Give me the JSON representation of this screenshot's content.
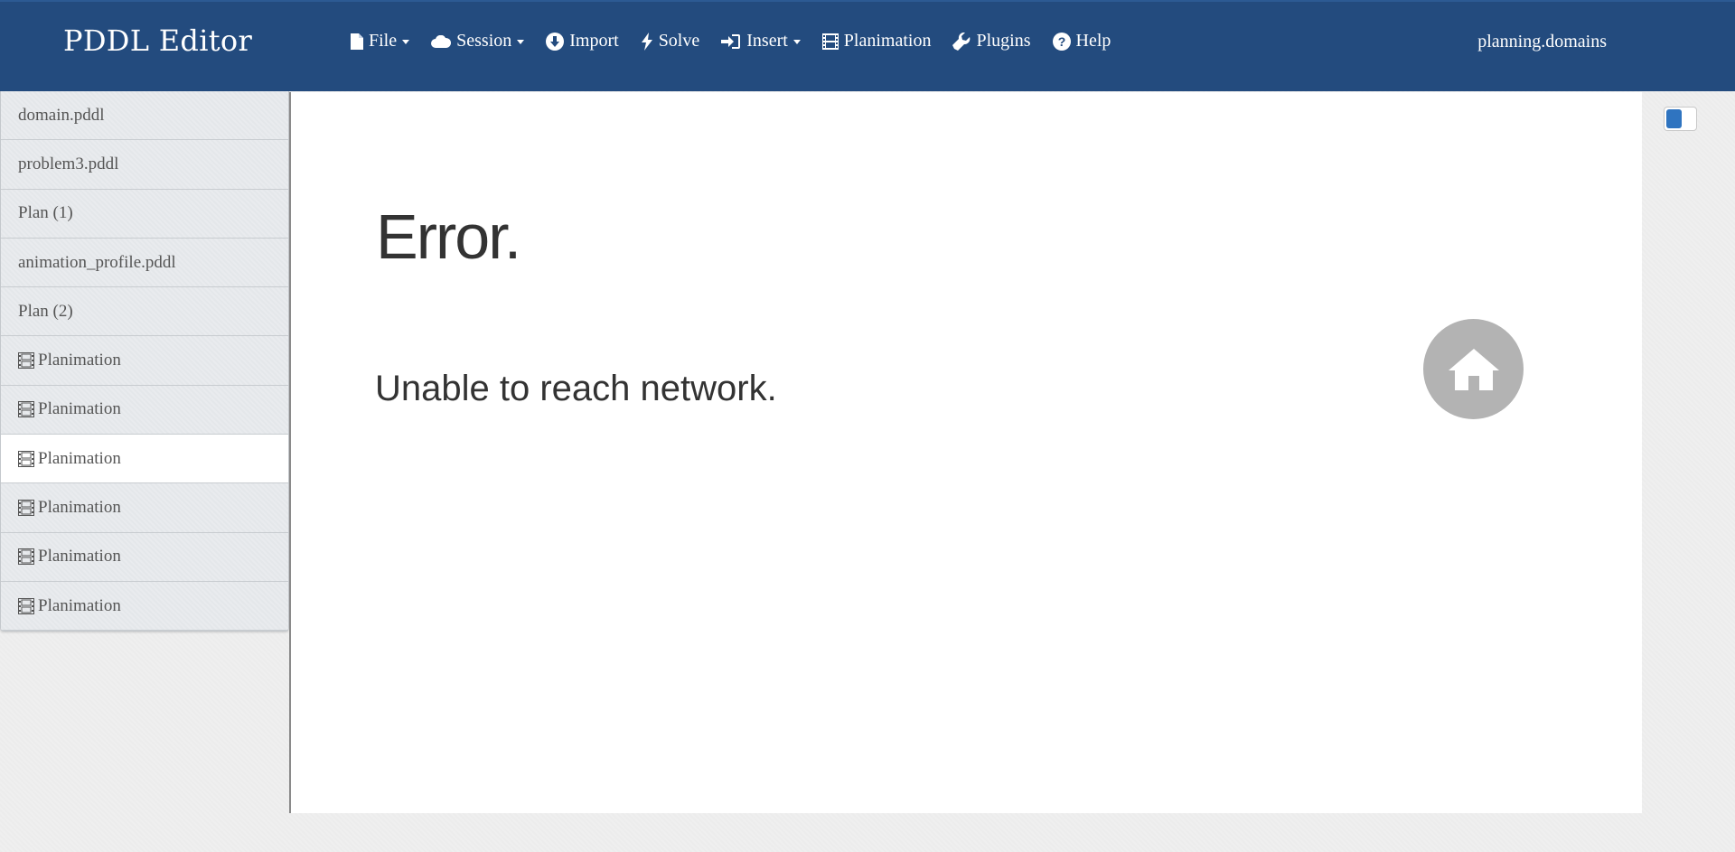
{
  "navbar": {
    "brand": "PDDL Editor",
    "menu": [
      {
        "label": "File",
        "icon": "file-icon",
        "dropdown": true
      },
      {
        "label": "Session",
        "icon": "cloud-icon",
        "dropdown": true
      },
      {
        "label": "Import",
        "icon": "download-circle-icon",
        "dropdown": false
      },
      {
        "label": "Solve",
        "icon": "bolt-icon",
        "dropdown": false
      },
      {
        "label": "Insert",
        "icon": "sign-in-icon",
        "dropdown": true
      },
      {
        "label": "Planimation",
        "icon": "film-icon",
        "dropdown": false
      },
      {
        "label": "Plugins",
        "icon": "wrench-icon",
        "dropdown": false
      },
      {
        "label": "Help",
        "icon": "question-circle-icon",
        "dropdown": false
      }
    ],
    "site_link": "planning.domains"
  },
  "sidebar": {
    "tabs": [
      {
        "label": "domain.pddl",
        "icon": "",
        "active": false
      },
      {
        "label": "problem3.pddl",
        "icon": "",
        "active": false
      },
      {
        "label": "Plan (1)",
        "icon": "",
        "active": false
      },
      {
        "label": "animation_profile.pddl",
        "icon": "",
        "active": false
      },
      {
        "label": "Plan (2)",
        "icon": "",
        "active": false
      },
      {
        "label": "Planimation",
        "icon": "film-icon",
        "active": false
      },
      {
        "label": "Planimation",
        "icon": "film-icon",
        "active": false
      },
      {
        "label": "Planimation",
        "icon": "film-icon",
        "active": true
      },
      {
        "label": "Planimation",
        "icon": "film-icon",
        "active": false
      },
      {
        "label": "Planimation",
        "icon": "film-icon",
        "active": false
      },
      {
        "label": "Planimation",
        "icon": "film-icon",
        "active": false
      }
    ]
  },
  "main": {
    "error_title": "Error.",
    "error_message": "Unable to reach network.",
    "home_button_icon": "home-icon"
  },
  "colors": {
    "navbar_bg": "#234b7e",
    "toggle_accent": "#2f74c0",
    "home_button_bg": "#b3b3b3"
  }
}
